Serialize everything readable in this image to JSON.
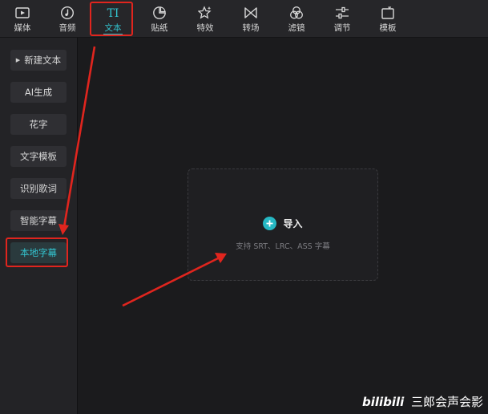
{
  "toolbar": {
    "items": [
      {
        "label": "媒体",
        "icon": "media-icon"
      },
      {
        "label": "音频",
        "icon": "audio-icon"
      },
      {
        "label": "文本",
        "icon": "text-icon",
        "active": true
      },
      {
        "label": "贴纸",
        "icon": "sticker-icon"
      },
      {
        "label": "特效",
        "icon": "effects-icon"
      },
      {
        "label": "转场",
        "icon": "transition-icon"
      },
      {
        "label": "滤镜",
        "icon": "filter-icon"
      },
      {
        "label": "调节",
        "icon": "adjust-icon"
      },
      {
        "label": "模板",
        "icon": "template-icon"
      }
    ]
  },
  "sidebar": {
    "items": [
      {
        "label": "新建文本",
        "caret": "▶"
      },
      {
        "label": "AI生成"
      },
      {
        "label": "花字"
      },
      {
        "label": "文字模板"
      },
      {
        "label": "识别歌词"
      },
      {
        "label": "智能字幕"
      },
      {
        "label": "本地字幕",
        "active": true
      }
    ]
  },
  "main": {
    "import_label": "导入",
    "import_hint": "支持 SRT、LRC、ASS 字幕"
  },
  "watermark": {
    "logo": "bilibili",
    "text": "三郎会声会影"
  },
  "colors": {
    "accent": "#33c4cf",
    "annotation": "#e0251e",
    "background": "#1b1b1d"
  }
}
